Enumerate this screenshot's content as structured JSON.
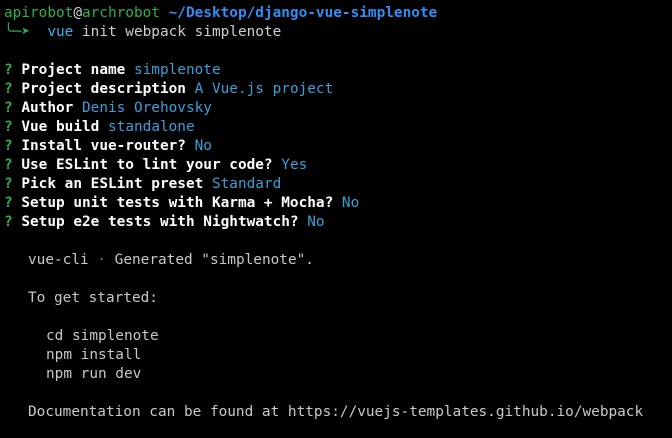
{
  "prompt": {
    "user": "apirobot",
    "at": "@",
    "host": "archrobot",
    "path": "~/Desktop/django-vue-simplenote",
    "corner_glyph": "╰─➤",
    "cmd_vue": "vue",
    "cmd_args": " init webpack simplenote"
  },
  "questions": [
    {
      "mark": "?",
      "label": "Project name",
      "answer": "simplenote"
    },
    {
      "mark": "?",
      "label": "Project description",
      "answer": "A Vue.js project"
    },
    {
      "mark": "?",
      "label": "Author",
      "answer": "Denis Orehovsky"
    },
    {
      "mark": "?",
      "label": "Vue build",
      "answer": "standalone"
    },
    {
      "mark": "?",
      "label": "Install vue-router?",
      "answer": "No"
    },
    {
      "mark": "?",
      "label": "Use ESLint to lint your code?",
      "answer": "Yes"
    },
    {
      "mark": "?",
      "label": "Pick an ESLint preset",
      "answer": "Standard"
    },
    {
      "mark": "?",
      "label": "Setup unit tests with Karma + Mocha?",
      "answer": "No"
    },
    {
      "mark": "?",
      "label": "Setup e2e tests with Nightwatch?",
      "answer": "No"
    }
  ],
  "output": {
    "generated_prefix": "vue-cli",
    "generated_dot": "·",
    "generated_text": "Generated \"simplenote\".",
    "get_started": "To get started:",
    "steps": [
      "cd simplenote",
      "npm install",
      "npm run dev"
    ],
    "docs": "Documentation can be found at https://vuejs-templates.github.io/webpack"
  },
  "colors": {
    "background": "#000000",
    "prompt_green": "#2bb34b",
    "path_blue": "#2f8ff5",
    "answer_cyan": "#3aa0d8"
  }
}
